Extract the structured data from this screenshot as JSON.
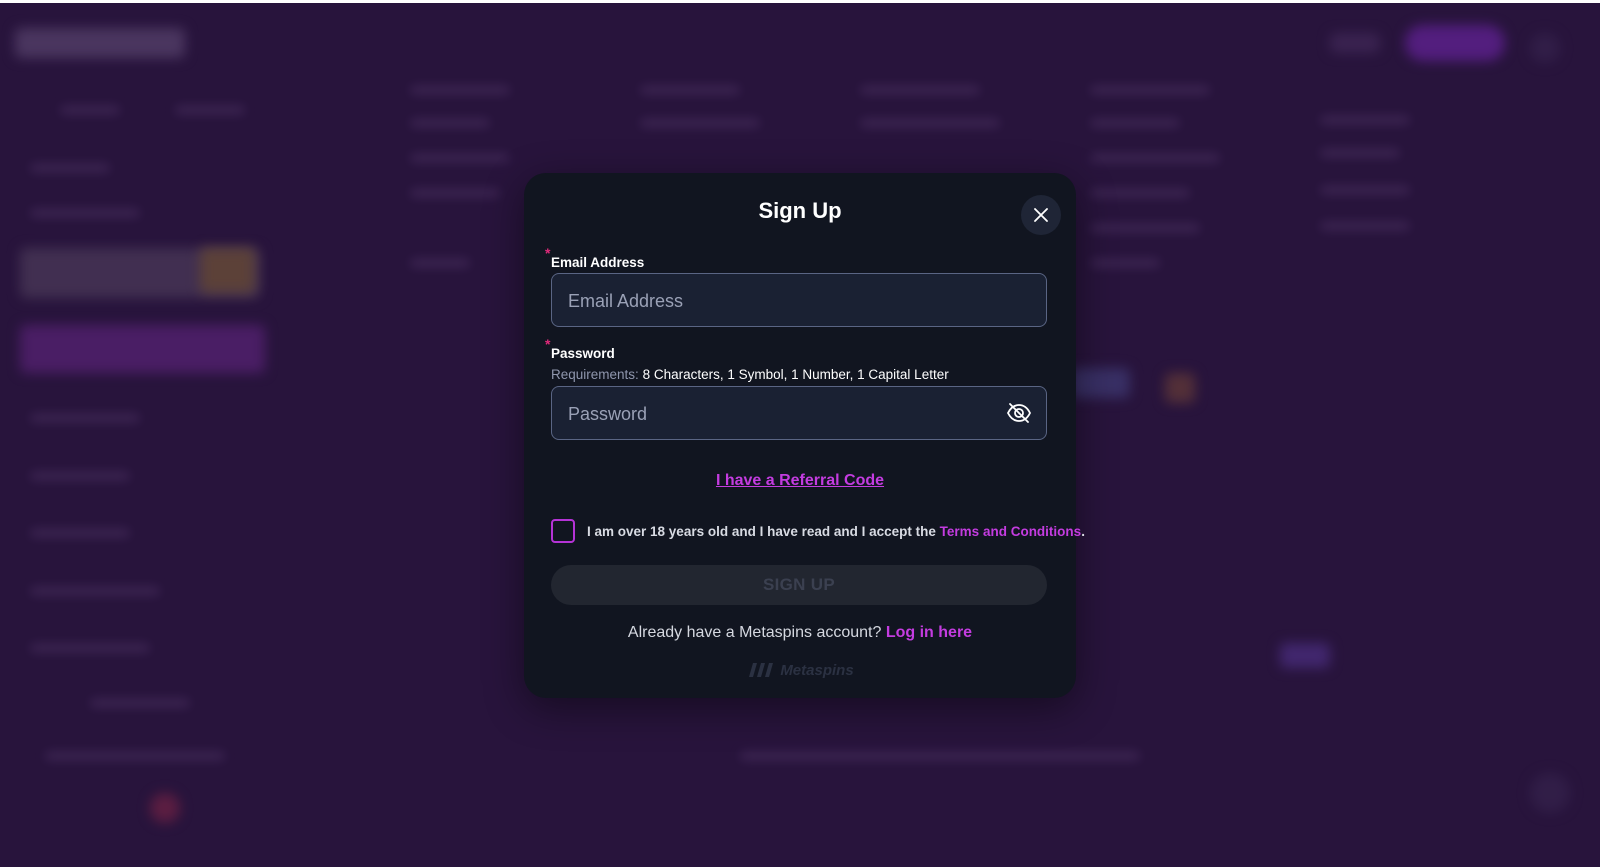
{
  "modal": {
    "title": "Sign Up",
    "email": {
      "label": "Email Address",
      "placeholder": "Email Address",
      "required_mark": "*"
    },
    "password": {
      "label": "Password",
      "requirements_label": "Requirements:",
      "requirements_value": "8 Characters, 1 Symbol, 1 Number, 1 Capital Letter",
      "placeholder": "Password",
      "required_mark": "*"
    },
    "referral_link": "I have a Referral Code",
    "consent": {
      "text": "I am over 18 years old and I have read and I accept the",
      "terms_link": "Terms and Conditions",
      "suffix": "."
    },
    "signup_button": "SIGN UP",
    "login_prompt": "Already have a Metaspins account?",
    "login_link": "Log in here",
    "brand": "Metaspins"
  },
  "colors": {
    "accent": "#c43ce0",
    "required": "#e0297a",
    "modal_bg": "#111520",
    "page_bg": "#2c1840"
  }
}
